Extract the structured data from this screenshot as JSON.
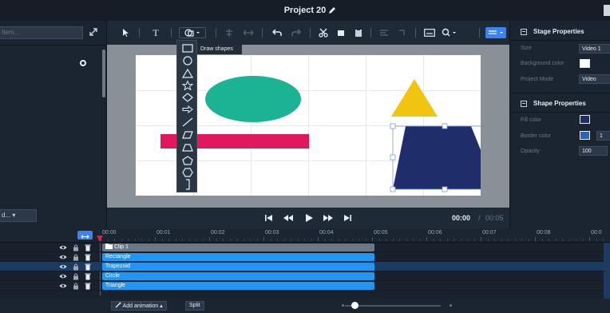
{
  "window": {
    "title": "Project 20"
  },
  "left_panel": {
    "search_placeholder": "Item...",
    "layout_select": "d..."
  },
  "toolbar": {
    "tools": [
      "select-tool",
      "text-tool",
      "shape-tool",
      "align-tool",
      "distribute-tool",
      "undo",
      "redo",
      "cut",
      "copy",
      "paste",
      "group",
      "subtitles",
      "zoom",
      "view-mode"
    ]
  },
  "shape_menu": {
    "tooltip": "Draw shapes",
    "items": [
      "rectangle",
      "circle",
      "triangle",
      "star",
      "diamond",
      "arrow",
      "line",
      "parallelogram",
      "trapezoid",
      "pentagon",
      "hexagon",
      "bracket"
    ]
  },
  "stage": {
    "shapes": [
      {
        "kind": "ellipse",
        "color": "#1bb394"
      },
      {
        "kind": "rectangle",
        "color": "#e0185e"
      },
      {
        "kind": "triangle",
        "color": "#f1c40f"
      },
      {
        "kind": "trapezoid",
        "color": "#1f2d6b",
        "selected": true
      }
    ]
  },
  "player": {
    "current_time": "00:00",
    "separator": "/",
    "total_time": "00:05"
  },
  "right_panel": {
    "stage_properties": {
      "heading": "Stage Properties",
      "size_label": "Size",
      "size_value": "Video 1",
      "bg_label": "Background color",
      "bg_color": "#ffffff",
      "mode_label": "Project Mode",
      "mode_value": "Video"
    },
    "shape_properties": {
      "heading": "Shape Properties",
      "fill_label": "Fill color",
      "fill_color": "#1f2d6b",
      "border_label": "Border color",
      "border_color": "#2563c4",
      "border_width": "1",
      "opacity_label": "Opacity",
      "opacity_value": "100"
    }
  },
  "timeline": {
    "ruler_labels": [
      "00:00",
      "00:01",
      "00:02",
      "00:03",
      "00:04",
      "00:05",
      "00:06",
      "00:07",
      "00:08",
      "00:0"
    ],
    "tracks": [
      {
        "name": "Clip 1",
        "type": "group"
      },
      {
        "name": "Rectangle",
        "type": "item"
      },
      {
        "name": "Trapezoid",
        "type": "item",
        "selected": true
      },
      {
        "name": "Circle",
        "type": "item"
      },
      {
        "name": "Triangle",
        "type": "item"
      }
    ]
  },
  "bottom_bar": {
    "add_animation": "Add animation",
    "split": "Split"
  }
}
